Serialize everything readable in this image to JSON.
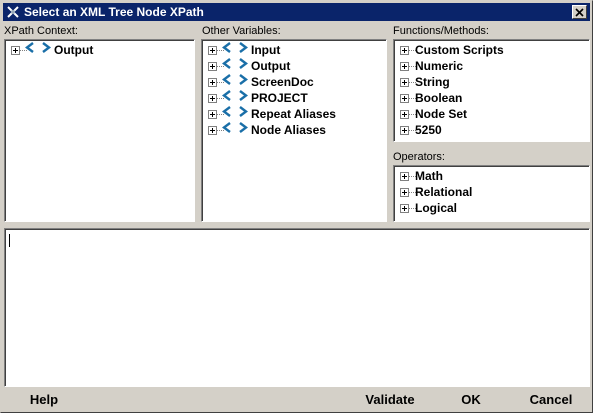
{
  "window": {
    "title": "Select an XML Tree Node XPath"
  },
  "xpath_context": {
    "label": "XPath Context:",
    "items": [
      {
        "label": "Output",
        "icon": "xml-node-icon"
      }
    ]
  },
  "other_variables": {
    "label": "Other Variables:",
    "items": [
      {
        "label": "Input",
        "icon": "xml-node-icon"
      },
      {
        "label": "Output",
        "icon": "xml-node-icon"
      },
      {
        "label": "ScreenDoc",
        "icon": "xml-node-icon"
      },
      {
        "label": "PROJECT",
        "icon": "xml-node-icon"
      },
      {
        "label": "Repeat Aliases",
        "icon": "xml-node-icon"
      },
      {
        "label": "Node Aliases",
        "icon": "xml-node-icon"
      }
    ]
  },
  "functions": {
    "label": "Functions/Methods:",
    "items": [
      {
        "label": "Custom Scripts"
      },
      {
        "label": "Numeric"
      },
      {
        "label": "String"
      },
      {
        "label": "Boolean"
      },
      {
        "label": "Node Set"
      },
      {
        "label": "5250"
      }
    ]
  },
  "operators": {
    "label": "Operators:",
    "items": [
      {
        "label": "Math"
      },
      {
        "label": "Relational"
      },
      {
        "label": "Logical"
      }
    ]
  },
  "editor": {
    "value": ""
  },
  "buttons": {
    "help": "Help",
    "validate": "Validate",
    "ok": "OK",
    "cancel": "Cancel"
  },
  "colors": {
    "titlebar": "#0a246a",
    "node_icon": "#1a6fa8",
    "face": "#d4d0c8"
  }
}
